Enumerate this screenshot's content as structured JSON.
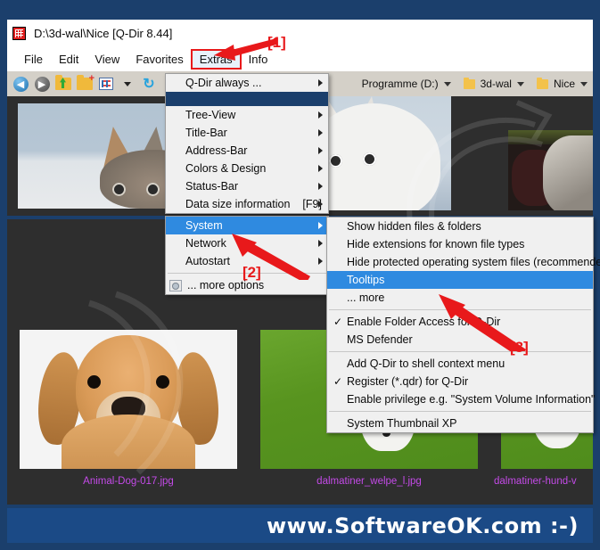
{
  "window": {
    "title": "D:\\3d-wal\\Nice  [Q-Dir 8.44]",
    "icon": "qdir-grid-icon"
  },
  "menubar": {
    "items": [
      {
        "label": "File",
        "active": false
      },
      {
        "label": "Edit",
        "active": false
      },
      {
        "label": "View",
        "active": false
      },
      {
        "label": "Favorites",
        "active": false
      },
      {
        "label": "Extras",
        "active": true
      },
      {
        "label": "Info",
        "active": false
      }
    ]
  },
  "toolbar": {
    "buttons": [
      {
        "icon": "back-arrow-icon"
      },
      {
        "icon": "forward-arrow-icon"
      },
      {
        "icon": "folder-up-icon"
      },
      {
        "icon": "new-folder-icon"
      },
      {
        "icon": "view-grid-icon"
      },
      {
        "icon": "chevron-down-icon"
      },
      {
        "icon": "refresh-icon"
      },
      {
        "icon": "monitor-icon"
      }
    ],
    "address": [
      {
        "label": "Programme (D:)",
        "icon": "drive-icon"
      },
      {
        "label": "3d-wal",
        "icon": "folder-icon"
      },
      {
        "label": "Nice",
        "icon": "folder-icon"
      }
    ]
  },
  "extras_menu": {
    "items": [
      {
        "label": "Q-Dir always ...",
        "submenu": true,
        "type": "item"
      },
      {
        "type": "band"
      },
      {
        "label": "Tree-View",
        "submenu": true,
        "type": "item"
      },
      {
        "label": "Title-Bar",
        "submenu": true,
        "type": "item"
      },
      {
        "label": "Address-Bar",
        "submenu": true,
        "type": "item"
      },
      {
        "label": "Colors & Design",
        "submenu": true,
        "type": "item"
      },
      {
        "label": "Status-Bar",
        "submenu": true,
        "type": "item"
      },
      {
        "label": "Data size information",
        "submenu": true,
        "type": "item",
        "accel": "[F9]"
      }
    ]
  },
  "extras_menu_lower": {
    "items": [
      {
        "label": "System",
        "submenu": true,
        "selected": true,
        "type": "item"
      },
      {
        "label": "Network",
        "submenu": true,
        "selected": false,
        "type": "item"
      },
      {
        "label": "Autostart",
        "submenu": true,
        "selected": false,
        "type": "item"
      },
      {
        "type": "sep"
      },
      {
        "label": "... more options",
        "submenu": false,
        "selected": false,
        "type": "item",
        "icon": "options-gear-icon"
      }
    ]
  },
  "system_submenu": {
    "items": [
      {
        "label": "Show hidden files & folders",
        "type": "item",
        "checked": false,
        "selected": false
      },
      {
        "label": "Hide extensions for known file types",
        "type": "item",
        "checked": false,
        "selected": false
      },
      {
        "label": "Hide protected operating system files (recommended)",
        "type": "item",
        "checked": false,
        "selected": false
      },
      {
        "label": "Tooltips",
        "type": "item",
        "checked": false,
        "selected": true
      },
      {
        "label": "... more",
        "type": "item",
        "checked": false,
        "selected": false
      },
      {
        "type": "sep"
      },
      {
        "label": "Enable Folder Access for Q-Dir",
        "type": "item",
        "checked": true,
        "selected": false
      },
      {
        "label": "MS Defender",
        "type": "item",
        "checked": false,
        "selected": false
      },
      {
        "type": "sep"
      },
      {
        "label": "Add Q-Dir to shell context menu",
        "type": "item",
        "checked": false,
        "selected": false
      },
      {
        "label": "Register (*.qdr) for Q-Dir",
        "type": "item",
        "checked": true,
        "selected": false
      },
      {
        "label": "Enable privilege e.g. \"System Volume Information\"",
        "type": "item",
        "checked": false,
        "selected": false
      },
      {
        "type": "sep"
      },
      {
        "label": "System Thumbnail XP",
        "type": "item",
        "checked": false,
        "selected": false
      }
    ]
  },
  "thumbnails": {
    "labels": [
      "Animal-Dog-017.jpg",
      "dalmatiner_welpe_l.jpg",
      "dalmatiner-hund-v"
    ]
  },
  "annotations": {
    "tags": [
      "[1]",
      "[2]",
      "[3]"
    ],
    "arrow_color": "#e8191b"
  },
  "footer": {
    "text": "www.SoftwareOK.com  :-)"
  },
  "colors": {
    "frame": "#1b3f6c",
    "menu_bg": "#f0f0f0",
    "highlight": "#2f8ae0",
    "accent_red": "#e8191b",
    "label_violet": "#c44ae8",
    "footer_bg": "#1b4a86",
    "pane_bg": "#2e2e2e"
  }
}
